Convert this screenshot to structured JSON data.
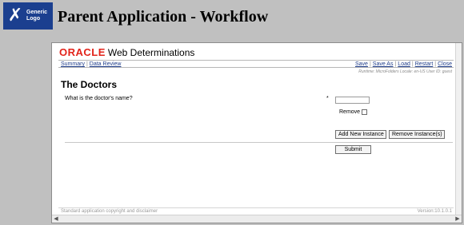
{
  "app": {
    "logo_lines": [
      "Generic",
      "Logo"
    ],
    "title": "Parent Application - Workflow"
  },
  "brand": {
    "oracle": "ORACLE",
    "product": "Web Determinations"
  },
  "nav": {
    "left": [
      "Summary",
      "Data Review"
    ],
    "right": [
      "Save",
      "Save As",
      "Load",
      "Restart",
      "Close"
    ],
    "separator": "|"
  },
  "runtime_info": "Runtime: MicroFolders Locale: en-US User ID: guest",
  "page": {
    "title": "The Doctors",
    "question": "What is the doctor's name?",
    "required_mark": "*",
    "name_value": "",
    "remove_label": "Remove",
    "remove_checked": false
  },
  "buttons": {
    "add_instance": "Add New Instance",
    "remove_instances": "Remove Instance(s)",
    "submit": "Submit"
  },
  "footer": {
    "copyright": "Standard application copyright and disclaimer",
    "version": "Version:10.1.0.1"
  },
  "colors": {
    "background": "#c0c0c0",
    "logo_bg": "#1b3f8f",
    "oracle_red": "#e2231a",
    "link": "#1f3d8a"
  }
}
